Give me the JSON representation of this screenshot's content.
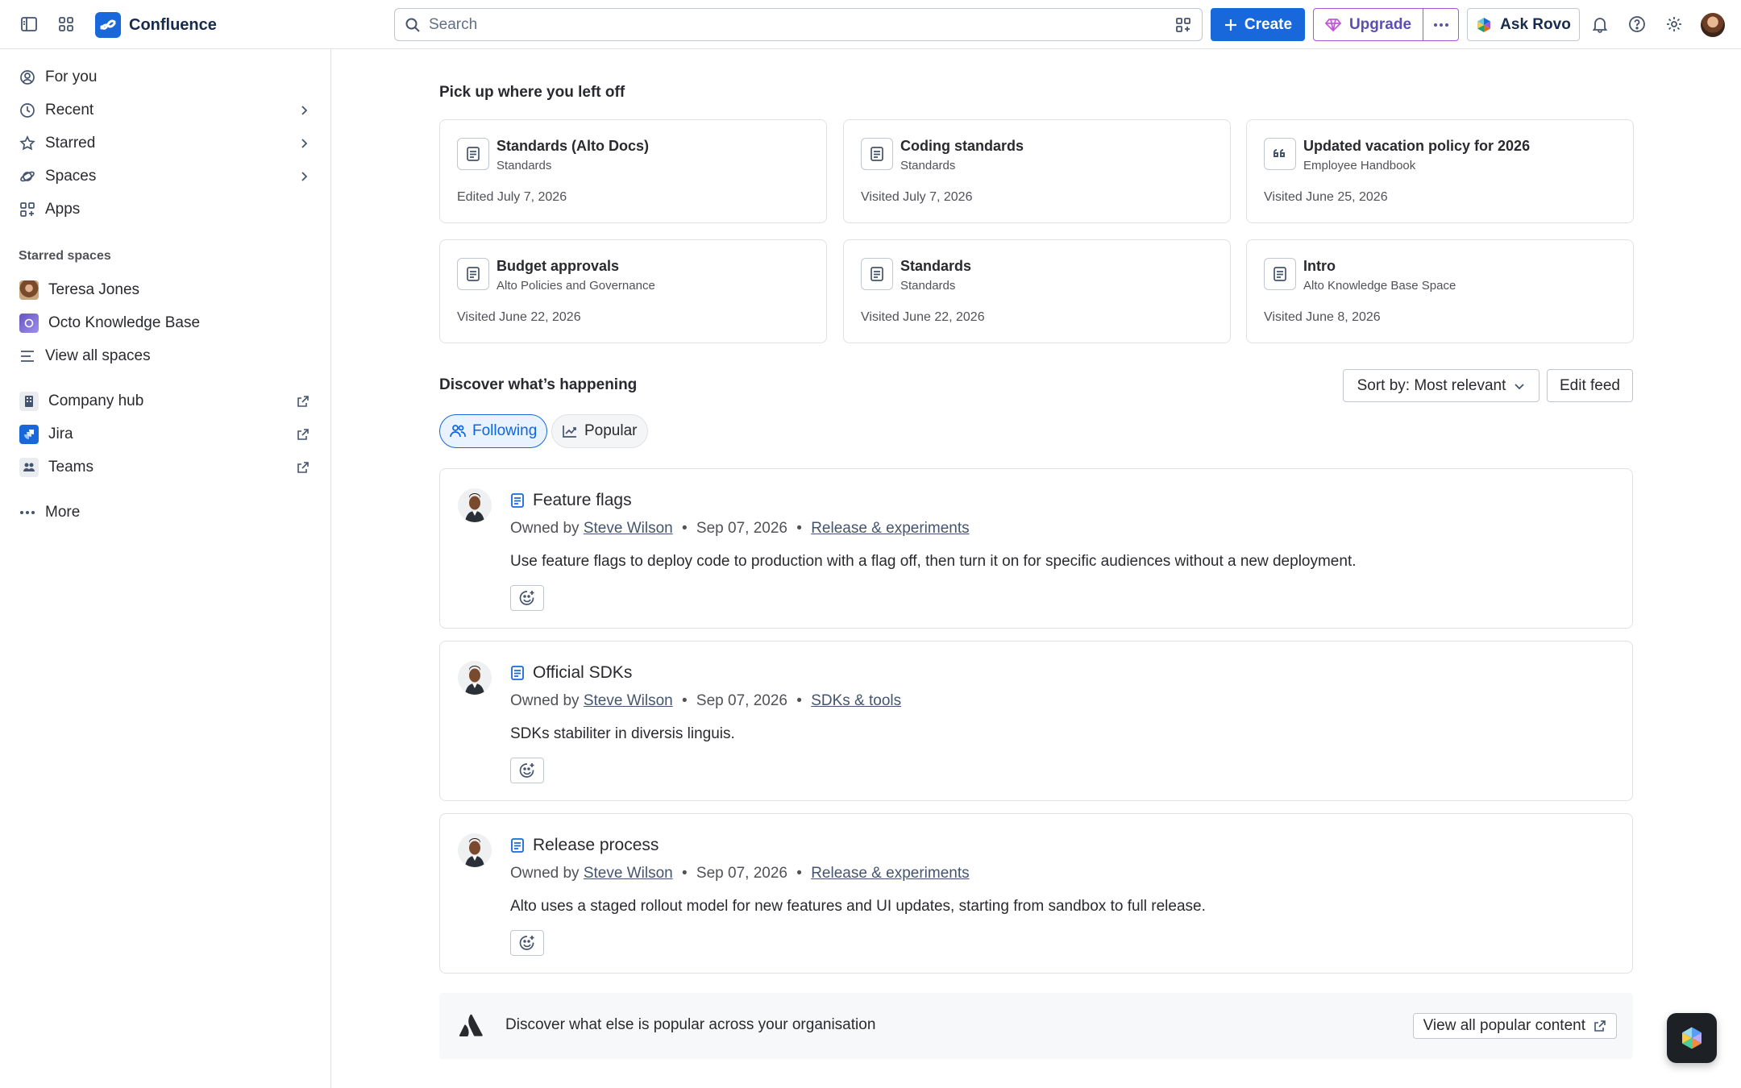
{
  "topbar": {
    "app_name": "Confluence",
    "search_placeholder": "Search",
    "create_label": "Create",
    "upgrade_label": "Upgrade",
    "ask_rovo_label": "Ask Rovo",
    "icons": [
      "sidebar-toggle-icon",
      "app-switcher-icon",
      "confluence-logo-icon",
      "search-icon",
      "filter-icon",
      "plus-icon",
      "diamond-icon",
      "more-icon",
      "rovo-icon",
      "bell-icon",
      "help-icon",
      "gear-icon"
    ],
    "brand_color": "#1868db"
  },
  "sidebar": {
    "nav": [
      {
        "label": "For you",
        "icon": "for-you-icon"
      },
      {
        "label": "Recent",
        "icon": "clock-icon"
      },
      {
        "label": "Starred",
        "icon": "star-icon"
      },
      {
        "label": "Spaces",
        "icon": "spaces-icon"
      },
      {
        "label": "Apps",
        "icon": "apps-icon"
      }
    ],
    "starred_heading": "Starred spaces",
    "starred_spaces": [
      {
        "label": "Teresa Jones"
      },
      {
        "label": "Octo Knowledge Base"
      },
      {
        "label": "View all spaces"
      }
    ],
    "apps": [
      {
        "label": "Company hub"
      },
      {
        "label": "Jira"
      },
      {
        "label": "Teams"
      }
    ],
    "more_label": "More"
  },
  "main": {
    "recent_heading": "Pick up where you left off",
    "recent": [
      {
        "title": "Standards (Alto Docs)",
        "space": "Standards",
        "meta": "Edited July 7, 2026",
        "icon": "page-icon"
      },
      {
        "title": "Coding standards",
        "space": "Standards",
        "meta": "Visited July 7, 2026",
        "icon": "page-icon"
      },
      {
        "title": "Updated vacation policy for 2026",
        "space": "Employee Handbook",
        "meta": "Visited June 25, 2026",
        "icon": "quote-icon"
      },
      {
        "title": "Budget approvals",
        "space": "Alto Policies and Governance",
        "meta": "Visited June 22, 2026",
        "icon": "page-icon"
      },
      {
        "title": "Standards",
        "space": "Standards",
        "meta": "Visited June 22, 2026",
        "icon": "page-icon"
      },
      {
        "title": "Intro",
        "space": "Alto Knowledge Base Space",
        "meta": "Visited June 8, 2026",
        "icon": "page-icon"
      }
    ],
    "discover_heading": "Discover what’s happening",
    "sort_label": "Sort by: Most relevant",
    "edit_feed_label": "Edit feed",
    "tabs": [
      {
        "label": "Following",
        "active": true
      },
      {
        "label": "Popular",
        "active": false
      }
    ],
    "feed": [
      {
        "title": "Feature flags",
        "owned_by": "Owned by",
        "owner": "Steve Wilson",
        "date": "Sep 07, 2026",
        "space": "Release & experiments",
        "excerpt": "Use feature flags to deploy code to production with a flag off, then turn it on for specific audiences without a new deployment."
      },
      {
        "title": "Official SDKs",
        "owned_by": "Owned by",
        "owner": "Steve Wilson",
        "date": "Sep 07, 2026",
        "space": "SDKs & tools",
        "excerpt": "SDKs stabiliter in diversis linguis."
      },
      {
        "title": "Release process",
        "owned_by": "Owned by",
        "owner": "Steve Wilson",
        "date": "Sep 07, 2026",
        "space": "Release & experiments",
        "excerpt": "Alto uses a staged rollout model for new features and UI updates, starting from sandbox to full release."
      }
    ],
    "banner_text": "Discover what else is popular across your organisation",
    "banner_button": "View all popular content"
  }
}
